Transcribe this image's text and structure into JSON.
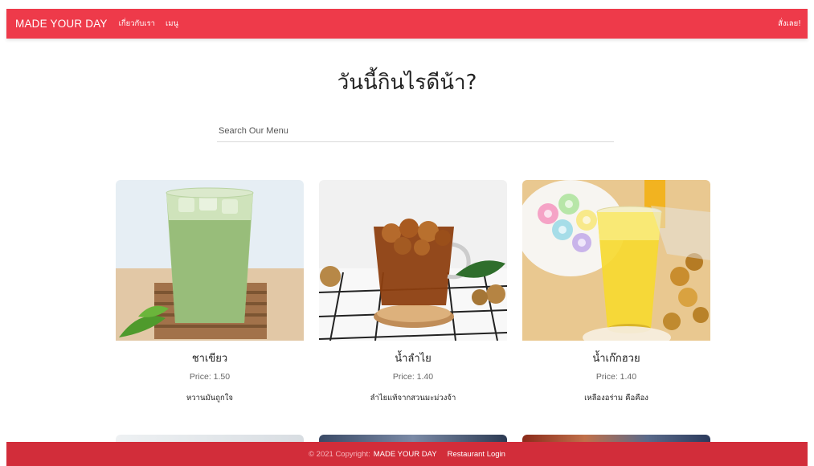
{
  "navbar": {
    "brand": "MADE YOUR DAY",
    "links": [
      "เกี่ยวกับเรา",
      "เมนู"
    ],
    "order_link": "สั่งเลย!",
    "color": "#ee3a4a"
  },
  "hero": {
    "title": "วันนี้กินไรดีน้า?"
  },
  "search": {
    "placeholder": "Search Our Menu",
    "value": ""
  },
  "menu": [
    {
      "name": "ชาเขียว",
      "price": "Price: 1.50",
      "description": "หวานมันถูกใจ",
      "image": "green-tea-photo"
    },
    {
      "name": "น้ำลำไย",
      "price": "Price: 1.40",
      "description": "ลำไยแท้จากสวนมะม่วงจ้า",
      "image": "longan-drink-photo"
    },
    {
      "name": "น้ำเก๊กฮวย",
      "price": "Price: 1.40",
      "description": "เหลืองอร่าม คือคือง",
      "image": "chrysanthemum-tea-photo"
    }
  ],
  "footer": {
    "copyright": "© 2021 Copyright:",
    "brand_link": "MADE YOUR DAY",
    "login_link": "Restaurant Login",
    "color": "#d22d3a"
  }
}
